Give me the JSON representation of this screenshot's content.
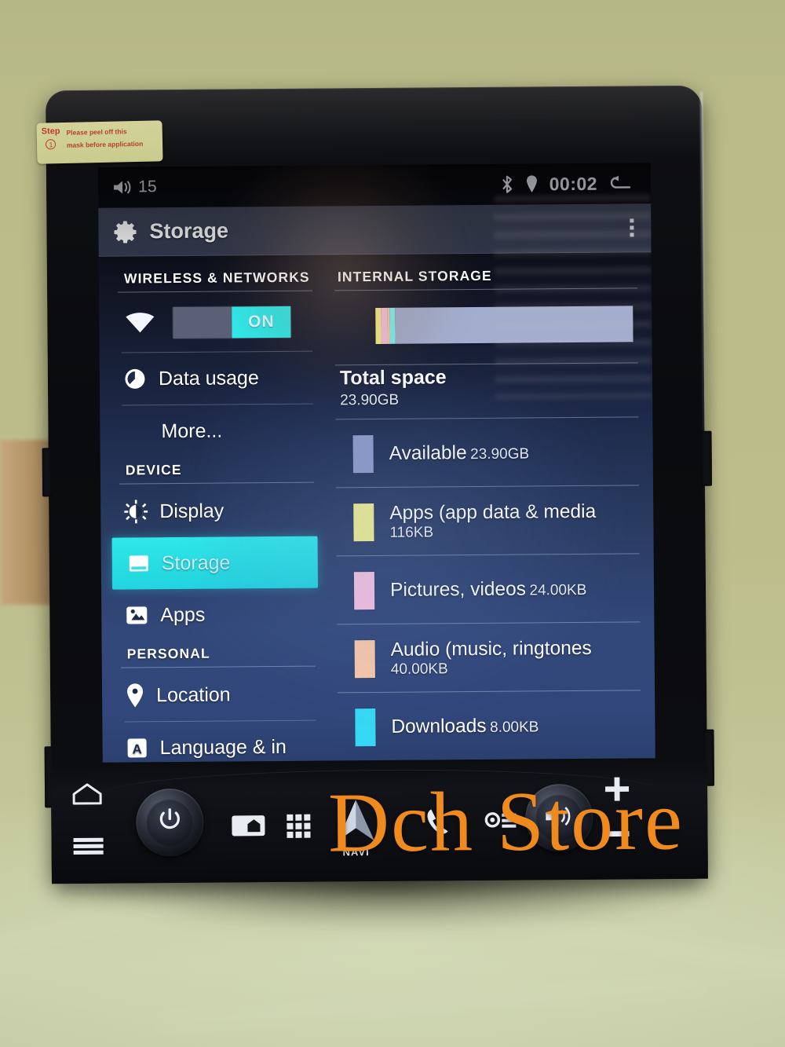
{
  "sticker": {
    "step_label": "Step",
    "step_number": "1",
    "line1": "Please peel off this",
    "line2": "mask before application"
  },
  "statusbar": {
    "volume_icon": "volume-icon",
    "volume_level": "15",
    "bluetooth_icon": "bluetooth-icon",
    "location_icon": "location-pin-icon",
    "clock": "00:02",
    "back_icon": "back-arrow-icon"
  },
  "actionbar": {
    "gear_icon": "gear-icon",
    "title": "Storage",
    "overflow_icon": "overflow-menu-icon"
  },
  "sidebar": {
    "sections": [
      {
        "header": "WIRELESS & NETWORKS",
        "items": [
          {
            "label": "",
            "icon": "wifi-icon",
            "type": "toggle",
            "toggle_off_label": "",
            "toggle_on_label": "ON",
            "state": "on"
          },
          {
            "label": "Data usage",
            "icon": "data-usage-icon",
            "type": "link"
          },
          {
            "label": "More...",
            "icon": "",
            "type": "link"
          }
        ]
      },
      {
        "header": "DEVICE",
        "items": [
          {
            "label": "Display",
            "icon": "brightness-icon",
            "type": "link"
          },
          {
            "label": "Storage",
            "icon": "storage-icon",
            "type": "link",
            "selected": true
          },
          {
            "label": "Apps",
            "icon": "apps-icon",
            "type": "link"
          }
        ]
      },
      {
        "header": "PERSONAL",
        "items": [
          {
            "label": "Location",
            "icon": "location-pin-icon",
            "type": "link"
          },
          {
            "label": "Language & in",
            "icon": "language-icon",
            "type": "link"
          }
        ]
      }
    ]
  },
  "storage": {
    "section_header": "INTERNAL STORAGE",
    "total_label": "Total space",
    "total_value": "23.90GB",
    "bar_segments": [
      {
        "name": "apps",
        "color": "#f2f08a",
        "percent": 2.0
      },
      {
        "name": "pictures",
        "color": "#f6c2dd",
        "percent": 2.6
      },
      {
        "name": "audio",
        "color": "#f9c9a8",
        "percent": 0.9
      },
      {
        "name": "downloads",
        "color": "#7ff0f5",
        "percent": 2.2
      },
      {
        "name": "available",
        "color": "#a3adcd",
        "percent": 92.3
      }
    ],
    "categories": [
      {
        "label": "Available",
        "value": "23.90GB",
        "color": "#8f9ac6"
      },
      {
        "label": "Apps (app data & media",
        "value": "116KB",
        "color": "#f2f08a"
      },
      {
        "label": "Pictures, videos",
        "value": "24.00KB",
        "color": "#f6c2dd"
      },
      {
        "label": "Audio (music, ringtones",
        "value": "40.00KB",
        "color": "#f9c9a8"
      },
      {
        "label": "Downloads",
        "value": "8.00KB",
        "color": "#36d7f2"
      }
    ]
  },
  "hardware": {
    "buttons": [
      {
        "name": "home-button",
        "icon": "home-icon"
      },
      {
        "name": "menu-button",
        "icon": "menu-icon"
      },
      {
        "name": "power-knob",
        "icon": "power-icon"
      },
      {
        "name": "screen-home-button",
        "icon": "screen-home-icon"
      },
      {
        "name": "keypad-button",
        "icon": "grid-icon"
      },
      {
        "name": "navi-button",
        "icon": "navigation-arrow-icon",
        "label": "NAVI"
      },
      {
        "name": "phone-button",
        "icon": "phone-icon"
      },
      {
        "name": "settings-button",
        "icon": "settings-icon"
      },
      {
        "name": "volume-knob",
        "icon": "speaker-icon"
      },
      {
        "name": "volume-up-button",
        "icon": "plus-icon"
      },
      {
        "name": "volume-down-button",
        "icon": "minus-icon"
      }
    ]
  },
  "watermark": {
    "text": "Dch Store",
    "color": "#ef8a1e"
  }
}
